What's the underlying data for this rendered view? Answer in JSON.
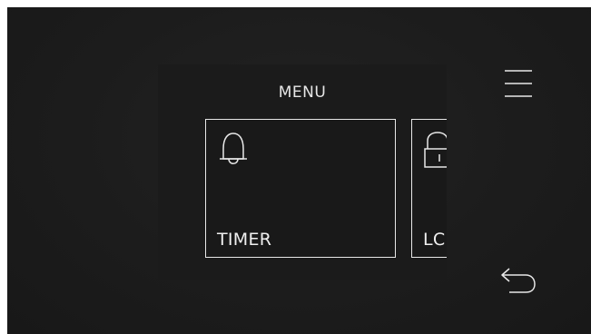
{
  "menu": {
    "title": "MENU",
    "tiles": [
      {
        "label": "TIMER",
        "icon": "bell-icon"
      },
      {
        "label": "LC",
        "icon": "unlock-icon"
      }
    ]
  },
  "controls": {
    "menu_icon": "hamburger-icon",
    "back_icon": "back-arrow-icon"
  },
  "colors": {
    "background": "#1c1c1c",
    "panel": "#1b1b1b",
    "foreground": "#e8e8e8"
  }
}
